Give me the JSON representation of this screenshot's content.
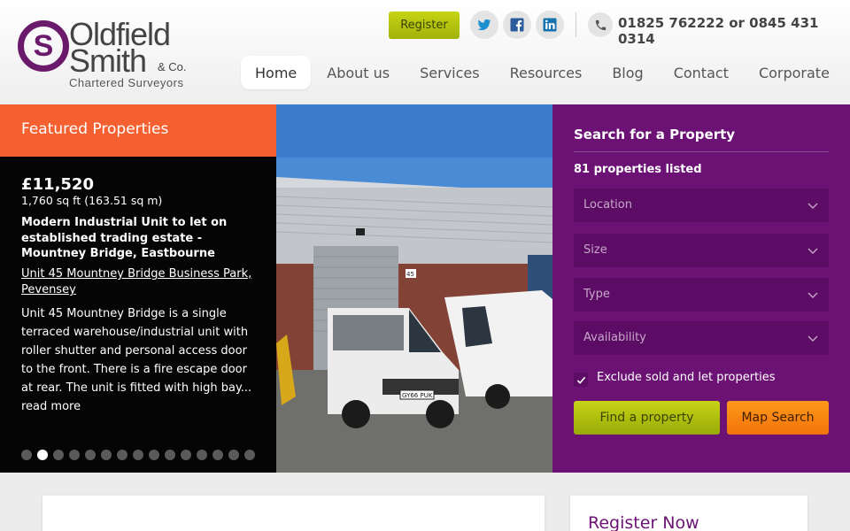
{
  "logo": {
    "initial": "S",
    "line1": "Oldfield",
    "line2": "Smith",
    "co": "& Co.",
    "tagline": "Chartered Surveyors"
  },
  "header": {
    "register_label": "Register",
    "social": [
      "twitter-icon",
      "facebook-icon",
      "linkedin-icon"
    ],
    "phone": "01825 762222 or 0845 431 0314"
  },
  "nav": {
    "items": [
      "Home",
      "About us",
      "Services",
      "Resources",
      "Blog",
      "Contact",
      "Corporate"
    ],
    "active": "Home"
  },
  "featured": {
    "heading": "Featured Properties",
    "price": "£11,520",
    "size": "1,760 sq ft (163.51 sq m)",
    "title": "Modern Industrial Unit to let on established trading estate - Mountney Bridge, Eastbourne",
    "address": "Unit 45 Mountney Bridge Business Park, Pevensey",
    "description": "Unit 45 Mountney Bridge is a single terraced warehouse/industrial unit with roller shutter and personal access door to the front. There is a fire escape door at rear. The unit is fitted with high bay...",
    "read_more": "read more",
    "slide_count": 15,
    "active_slide": 2
  },
  "photo": {
    "plate": "GY66 PUK",
    "unit_number": "45"
  },
  "search": {
    "title": "Search for a Property",
    "count": "81 properties listed",
    "location_placeholder": "Location",
    "size_placeholder": "Size",
    "type_placeholder": "Type",
    "availability_placeholder": "Availability",
    "exclude_label": "Exclude sold and let properties",
    "exclude_checked": true,
    "find_label": "Find a property",
    "map_label": "Map Search"
  },
  "lower": {
    "register_now": "Register Now"
  },
  "colors": {
    "brand_purple": "#6b1274",
    "featured_orange": "#f4602f",
    "accent_green": "#b3c30f",
    "accent_orange": "#f7851a"
  }
}
